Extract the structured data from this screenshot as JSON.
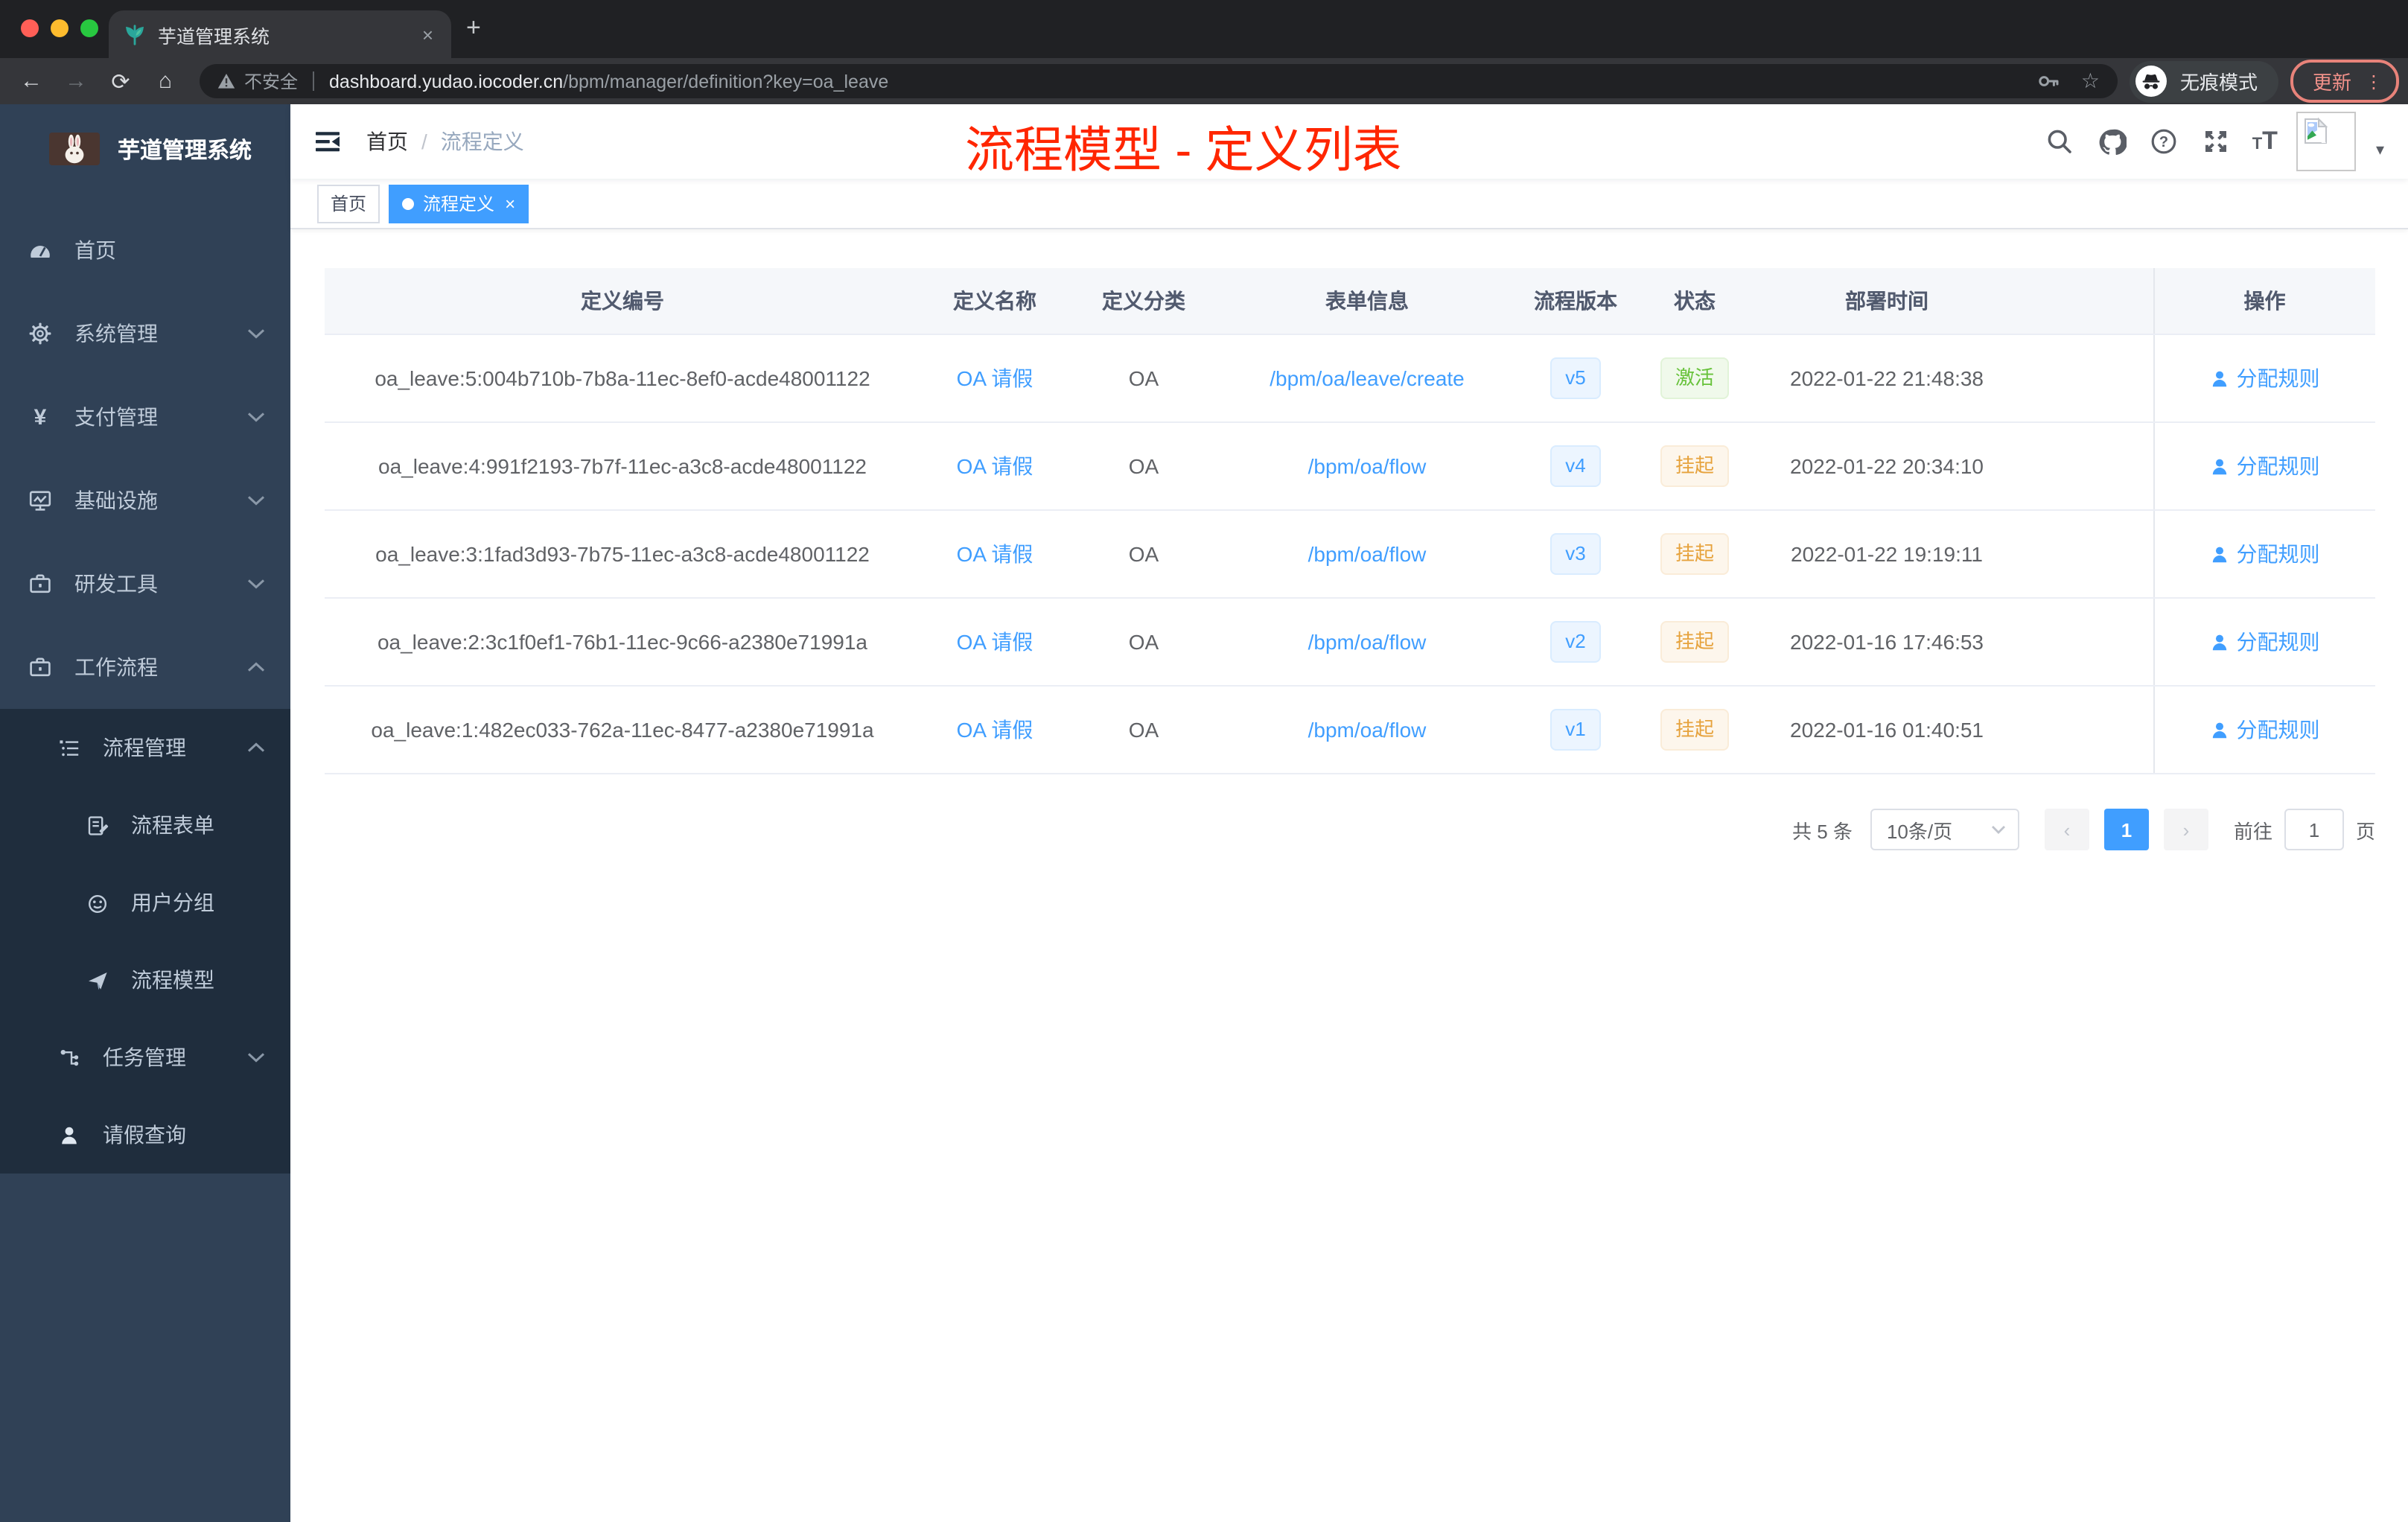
{
  "browser": {
    "tab_title": "芋道管理系统",
    "close_tab": "×",
    "new_tab": "+",
    "back": "←",
    "forward": "→",
    "reload": "⟳",
    "home": "⌂",
    "security_label": "不安全",
    "url_host": "dashboard.yudao.iocoder.cn",
    "url_path": "/bpm/manager/definition?key=oa_leave",
    "star": "☆",
    "incognito_label": "无痕模式",
    "update_label": "更新",
    "menu_dots": "⋮"
  },
  "app": {
    "logo_title": "芋道管理系统",
    "breadcrumb": {
      "home": "首页",
      "separator": "/",
      "current": "流程定义"
    },
    "annotation": "流程模型 - 定义列表",
    "annotation_color": "#ff2600",
    "tags": {
      "home": "首页",
      "active": "流程定义",
      "close": "×"
    },
    "avatar_caret": "▾"
  },
  "colors": {
    "accent": "#409eff",
    "sidebar_bg": "#304156",
    "submenu_bg": "#1f2d3d",
    "success": "#67c23a",
    "warning": "#e6a23c"
  },
  "sidebar": {
    "items": [
      {
        "label": "首页"
      },
      {
        "label": "系统管理"
      },
      {
        "label": "支付管理"
      },
      {
        "label": "基础设施"
      },
      {
        "label": "研发工具"
      },
      {
        "label": "工作流程"
      },
      {
        "label": "流程管理"
      },
      {
        "label": "流程表单"
      },
      {
        "label": "用户分组"
      },
      {
        "label": "流程模型"
      },
      {
        "label": "任务管理"
      },
      {
        "label": "请假查询"
      }
    ]
  },
  "table": {
    "headers": [
      "定义编号",
      "定义名称",
      "定义分类",
      "表单信息",
      "流程版本",
      "状态",
      "部署时间",
      "操作"
    ],
    "action_label": "分配规则",
    "rows": [
      {
        "id": "oa_leave:5:004b710b-7b8a-11ec-8ef0-acde48001122",
        "name": "OA 请假",
        "category": "OA",
        "form": "/bpm/oa/leave/create",
        "version": "v5",
        "status": "激活",
        "status_type": "success",
        "deploy_time": "2022-01-22 21:48:38"
      },
      {
        "id": "oa_leave:4:991f2193-7b7f-11ec-a3c8-acde48001122",
        "name": "OA 请假",
        "category": "OA",
        "form": "/bpm/oa/flow",
        "version": "v4",
        "status": "挂起",
        "status_type": "warning",
        "deploy_time": "2022-01-22 20:34:10"
      },
      {
        "id": "oa_leave:3:1fad3d93-7b75-11ec-a3c8-acde48001122",
        "name": "OA 请假",
        "category": "OA",
        "form": "/bpm/oa/flow",
        "version": "v3",
        "status": "挂起",
        "status_type": "warning",
        "deploy_time": "2022-01-22 19:19:11"
      },
      {
        "id": "oa_leave:2:3c1f0ef1-76b1-11ec-9c66-a2380e71991a",
        "name": "OA 请假",
        "category": "OA",
        "form": "/bpm/oa/flow",
        "version": "v2",
        "status": "挂起",
        "status_type": "warning",
        "deploy_time": "2022-01-16 17:46:53"
      },
      {
        "id": "oa_leave:1:482ec033-762a-11ec-8477-a2380e71991a",
        "name": "OA 请假",
        "category": "OA",
        "form": "/bpm/oa/flow",
        "version": "v1",
        "status": "挂起",
        "status_type": "warning",
        "deploy_time": "2022-01-16 01:40:51"
      }
    ]
  },
  "pagination": {
    "total": "共 5 条",
    "page_size": "10条/页",
    "prev": "‹",
    "page": "1",
    "next": "›",
    "goto_label": "前往",
    "goto_value": "1",
    "unit_label": "页"
  }
}
